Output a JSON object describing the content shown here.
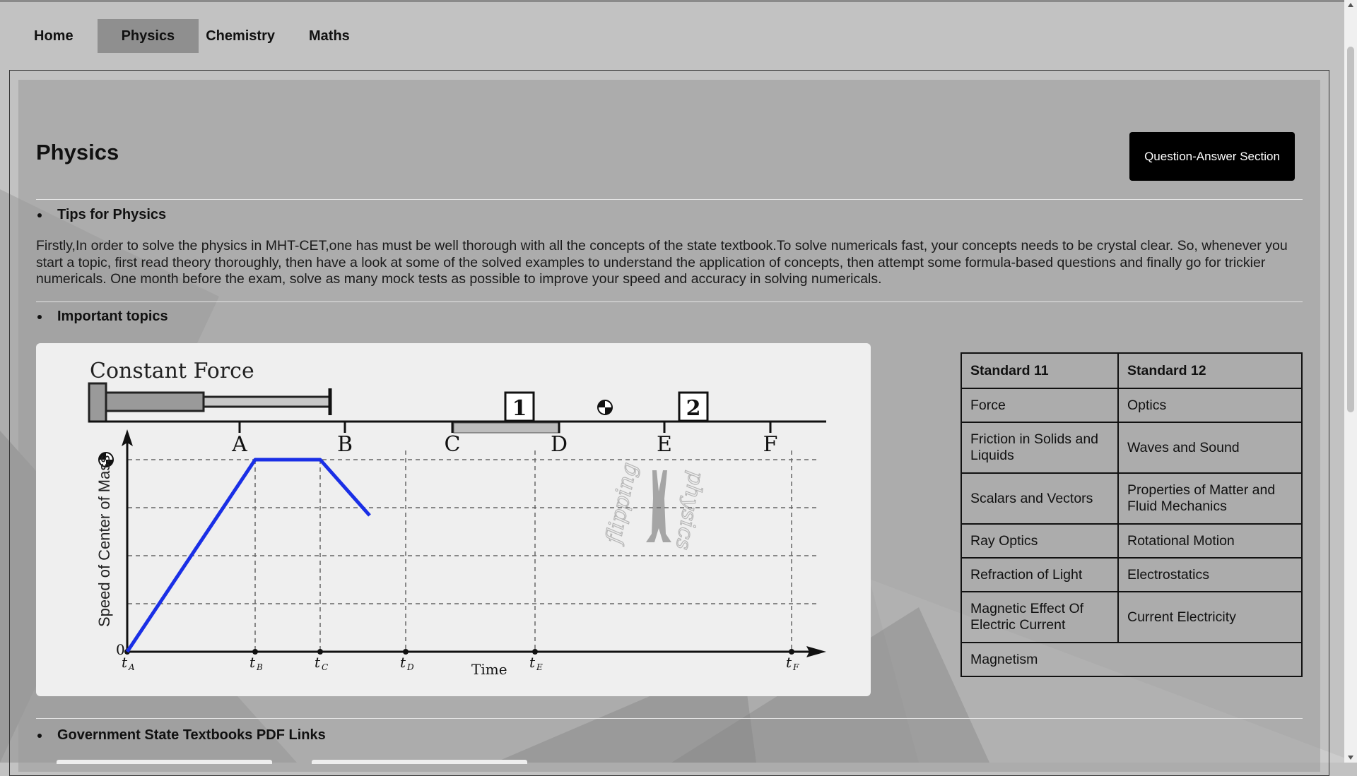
{
  "nav": {
    "items": [
      {
        "label": "Home",
        "active": false
      },
      {
        "label": "Physics",
        "active": true
      },
      {
        "label": "Chemistry",
        "active": false
      },
      {
        "label": "Maths",
        "active": false
      }
    ]
  },
  "page": {
    "title": "Physics",
    "qa_button": "Question-Answer Section"
  },
  "tips": {
    "heading": "Tips for Physics",
    "text": "Firstly,In order to solve the physics in MHT-CET,one has must be well thorough with all the concepts of the state textbook.To solve numericals fast, your concepts needs to be crystal clear. So, whenever you start a topic, first read theory thoroughly, then have a look at some of the solved examples to understand the application of concepts, then attempt some formula-based questions and finally go for trickier numericals. One month before the exam, solve as many mock tests as possible to improve your speed and accuracy in solving numericals."
  },
  "topics": {
    "heading": "Important topics",
    "diagram": {
      "title": "Constant Force",
      "ylabel": "Speed of Center of Mass",
      "xlabel": "Time",
      "zero": "0",
      "markers": [
        "A",
        "B",
        "C",
        "D",
        "E",
        "F"
      ],
      "boxes": [
        "1",
        "2"
      ],
      "t_labels": [
        "t",
        "t",
        "t",
        "t",
        "t",
        "t"
      ],
      "t_subs": [
        "A",
        "B",
        "C",
        "D",
        "E",
        "F"
      ],
      "watermark_left": "flipping",
      "watermark_right": "physics"
    },
    "table": {
      "headers": [
        "Standard 11",
        "Standard 12"
      ],
      "rows": [
        [
          "Force",
          "Optics"
        ],
        [
          "Friction in Solids and Liquids",
          "Waves and Sound"
        ],
        [
          "Scalars and Vectors",
          "Properties of Matter and Fluid Mechanics"
        ],
        [
          "Ray Optics",
          "Rotational Motion"
        ],
        [
          "Refraction of Light",
          "Electrostatics"
        ],
        [
          "Magnetic Effect Of Electric Current",
          "Current Electricity"
        ],
        [
          "Magnetism",
          ""
        ]
      ]
    }
  },
  "textbooks": {
    "heading": "Government State Textbooks PDF Links"
  },
  "colors": {
    "page_bg": "#c2c2c2",
    "active_tab": "#8f8f8f",
    "button_bg": "#000000",
    "graph_line": "#1a2fe6"
  }
}
